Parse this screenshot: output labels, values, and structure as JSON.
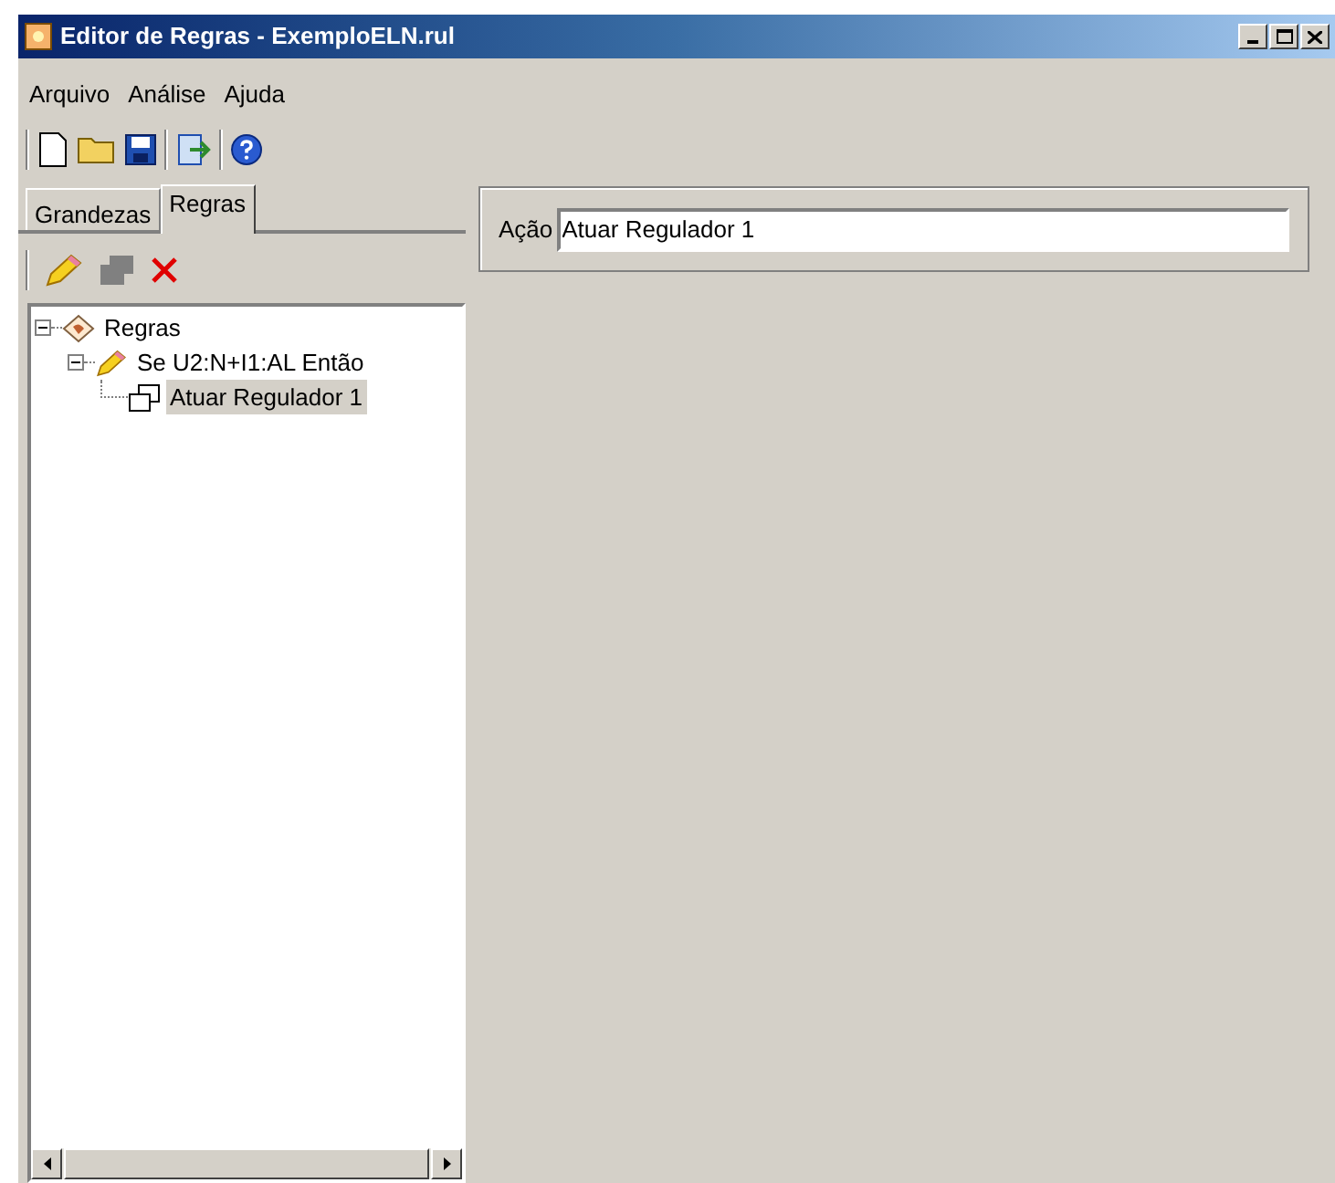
{
  "window": {
    "title": "Editor de Regras - ExemploELN.rul"
  },
  "menu": [
    "Arquivo",
    "Análise",
    "Ajuda"
  ],
  "tabs": [
    {
      "label": "Grandezas",
      "selected": false
    },
    {
      "label": "Regras",
      "selected": true
    }
  ],
  "tree": [
    {
      "label": "Regras",
      "kind": "root",
      "expanded": true,
      "selected": false,
      "children": [
        {
          "label": "Se U2:N+I1:AL Então",
          "kind": "rule",
          "expanded": true,
          "selected": false,
          "children": [
            {
              "label": "Atuar Regulador 1",
              "kind": "action",
              "selected": false,
              "highlighted": true
            }
          ]
        }
      ]
    }
  ],
  "action_field": {
    "label": "Ação",
    "value": "Atuar Regulador 1"
  }
}
